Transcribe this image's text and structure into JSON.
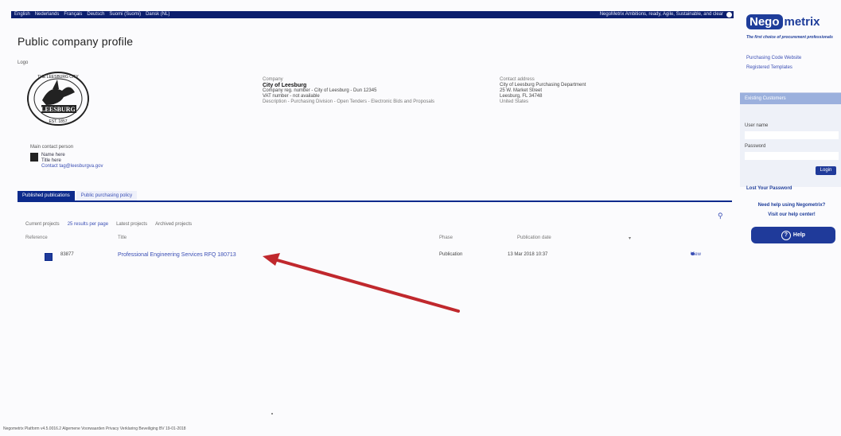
{
  "topbar": {
    "languages": [
      "English",
      "Nederlands",
      "Français",
      "Deutsch",
      "Suomi (Suomi)",
      "Dansk (NL)"
    ],
    "notice": "NegoMetrix Ambitions, ready, Agile, Sustainable, and clear"
  },
  "page": {
    "title": "Public company profile",
    "logo_label": "Logo",
    "contact_label": "Main contact person",
    "contact_name": "Name here",
    "contact_role": "Title here",
    "contact_email": "Contact tag@leesburgva.gov"
  },
  "seal": {
    "top": "THE LEESBURG CITY",
    "bottom": "LEESBURG",
    "est": "EST. 1857"
  },
  "company": {
    "label": "Company",
    "name": "City of Leesburg",
    "line1": "Company reg. number - City of Leesburg - Dun 12345",
    "line2": "VAT number - not available",
    "line3": "Description - Purchasing Division - Open Tenders - Electronic Bids and Proposals"
  },
  "address": {
    "label": "Contact address",
    "line1": "City of Leesburg Purchasing Department",
    "line2": "25 W. Market Street",
    "line3": "Leesburg, FL 34748",
    "line4": "United States"
  },
  "tabs": {
    "active": "Published publications",
    "inactive": "Public purchasing policy"
  },
  "filters": {
    "label": "Current projects",
    "show": "25 results per page",
    "opt1": "Latest projects",
    "opt2": "Archived projects"
  },
  "table": {
    "headers": [
      "Reference",
      "Title",
      "Phase",
      "Publication date"
    ],
    "rows": [
      {
        "ref": "83877",
        "title": "Professional Engineering Services RFQ 180713",
        "phase": "Publication",
        "date": "13 Mar 2018 10:37",
        "action": "View"
      }
    ]
  },
  "sidebar": {
    "brand_a": "Nego",
    "brand_b": "metrix",
    "tagline": "The first choice of procurement professionals",
    "link1": "Purchasing Code Website",
    "link2": "Registered Templates",
    "login_head": "Existing Customers",
    "username_label": "User name",
    "password_label": "Password",
    "login_btn": "Login",
    "forgot": "Lost Your Password",
    "need_help": "Need help using Negometrix?",
    "visit_help": "Visit our help center!",
    "help_btn": "Help"
  },
  "footer": "Negometrix Platform v4.5.0016.2 Algemene Voorwaarden Privacy Verklaring Beveiliging BV 19-01-2018"
}
